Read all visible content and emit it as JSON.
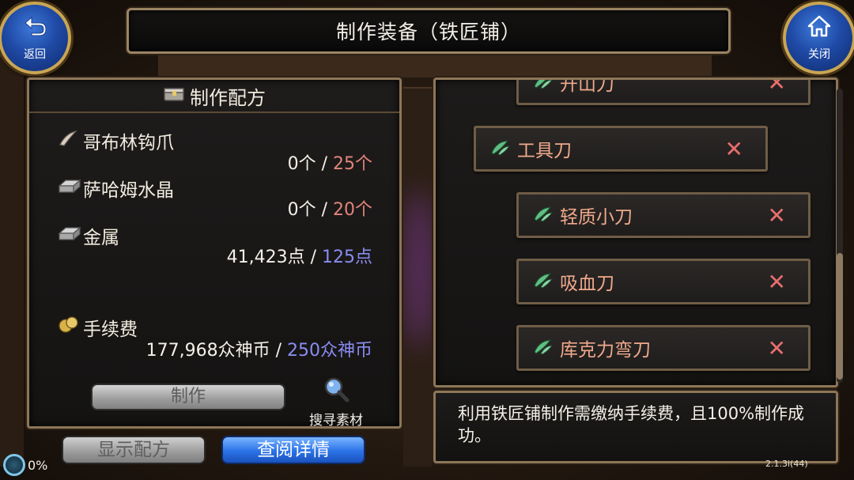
{
  "header": {
    "title": "制作装备（铁匠铺）",
    "back_label": "返回",
    "close_label": "关闭"
  },
  "recipe_panel": {
    "title": "制作配方",
    "materials": [
      {
        "icon": "claw-icon",
        "name": "哥布林钩爪",
        "have": "0个",
        "need": "25个"
      },
      {
        "icon": "ingot-icon",
        "name": "萨哈姆水晶",
        "have": "0个",
        "need": "20个"
      },
      {
        "icon": "ingot-icon",
        "name": "金属",
        "have": "41,423点",
        "need": "125点"
      }
    ],
    "fee": {
      "icon": "coin-icon",
      "name": "手续费",
      "have": "177,968众神币",
      "need": "250众神币"
    },
    "make_label": "制作",
    "search_label": "搜寻素材"
  },
  "bottom": {
    "show_recipe_label": "显示配方",
    "view_detail_label": "查阅详情",
    "progress": "0%"
  },
  "item_list": [
    {
      "name": "开山刀",
      "icon": "leaf-icon"
    },
    {
      "name": "工具刀",
      "icon": "leaf-icon"
    },
    {
      "name": "轻质小刀",
      "icon": "leaf-icon"
    },
    {
      "name": "吸血刀",
      "icon": "leaf-icon"
    },
    {
      "name": "库克力弯刀",
      "icon": "leaf-icon"
    }
  ],
  "info_text": "利用铁匠铺制作需缴纳手续费，且100%制作成功。",
  "version": "2.1.3i(44)",
  "colors": {
    "need_insufficient": "#e2847a",
    "need_sufficient": "#8a8cf2",
    "item_name": "#f0a98c",
    "panel_border": "#8d7658"
  }
}
